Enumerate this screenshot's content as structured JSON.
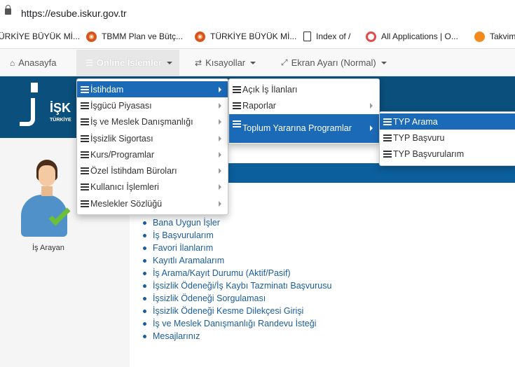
{
  "browser": {
    "url": "https://esube.iskur.gov.tr",
    "bookmarks": [
      {
        "label": "ÜRKİYE BÜYÜK Mİ...",
        "icon": "none"
      },
      {
        "label": "TBMM Plan ve Bütç...",
        "icon": "tbmm-icon"
      },
      {
        "label": "TÜRKİYE BÜYÜK Mİ...",
        "icon": "tbmm-icon"
      },
      {
        "label": "Index of /",
        "icon": "document-icon"
      },
      {
        "label": "All Applications | O...",
        "icon": "apps-icon"
      },
      {
        "label": "Takvim",
        "icon": "takvim-icon"
      }
    ]
  },
  "navbar": {
    "home": "Anasayfa",
    "online": "Online İşlemler",
    "shortcuts": "Kısayollar",
    "screen": "Ekran Ayarı (Normal)"
  },
  "logo": {
    "text": "İŞK",
    "subtext": "TÜRKİYE"
  },
  "menu1": [
    "İstihdam",
    "İşgücü Piyasası",
    "İş ve Meslek Danışmanlığı",
    "İşsizlik Sigortası",
    "Kurs/Programlar",
    "Özel İstihdam Büroları",
    "Kullanıcı İşlemleri",
    "Meslekler Sözlüğü"
  ],
  "menu2": [
    "Açık İş İlanları",
    "Raporlar",
    "Toplum Yararına Programlar"
  ],
  "menu3": [
    "TYP Arama",
    "TYP Başvuru",
    "TYP Başvurularım"
  ],
  "user": {
    "label": "İş Arayan"
  },
  "links": [
    "Bana Uygun İşler",
    "İş Başvurularım",
    "Favori İlanlarım",
    "Kayıtlı Aramalarım",
    "İş Arama/Kayıt Durumu (Aktif/Pasif)",
    "İşsizlik Ödeneği/İş Kaybı Tazminatı Başvurusu",
    "İşsizlik Ödeneği Sorgulaması",
    "İşsizlik Ödeneği Kesme Dilekçesi Girişi",
    "İş ve Meslek Danışmanlığı Randevu İsteği",
    "Mesajlarınız"
  ],
  "colors": {
    "accent": "#1b6ab8",
    "banner": "#0b4f7c",
    "link": "#1a5d9c"
  }
}
